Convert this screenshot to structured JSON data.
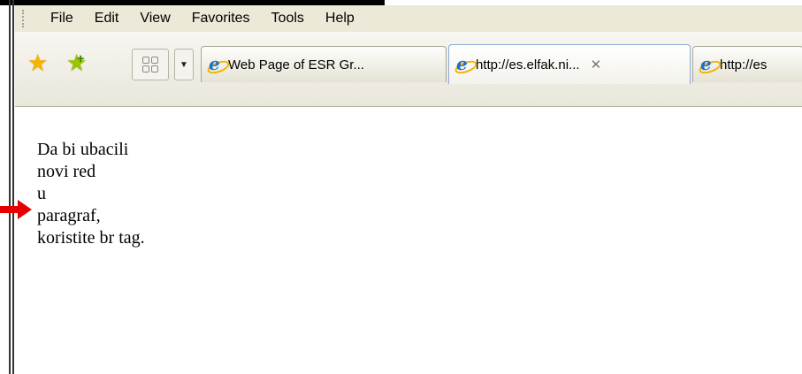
{
  "menu": {
    "items": [
      "File",
      "Edit",
      "View",
      "Favorites",
      "Tools",
      "Help"
    ]
  },
  "tabs": [
    {
      "label": "Web Page of ESR Gr...",
      "active": false
    },
    {
      "label": "http://es.elfak.ni...",
      "active": true,
      "close": "✕"
    },
    {
      "label": "http://es",
      "active": false
    }
  ],
  "icons": {
    "favorites": "star-icon",
    "add_favorite": "add-star-icon",
    "quick_tabs": "quick-tabs-icon",
    "tab_list": "dropdown-icon",
    "page": "ie-page-icon",
    "annotation": "red-arrow-icon"
  },
  "content": {
    "lines": [
      "Da bi ubacili",
      "novi red",
      "u",
      "paragraf,",
      "koristite br tag."
    ]
  },
  "colors": {
    "chrome": "#ece9d8",
    "arrow": "#e60000",
    "active_tab_border": "#8fa8d6"
  }
}
